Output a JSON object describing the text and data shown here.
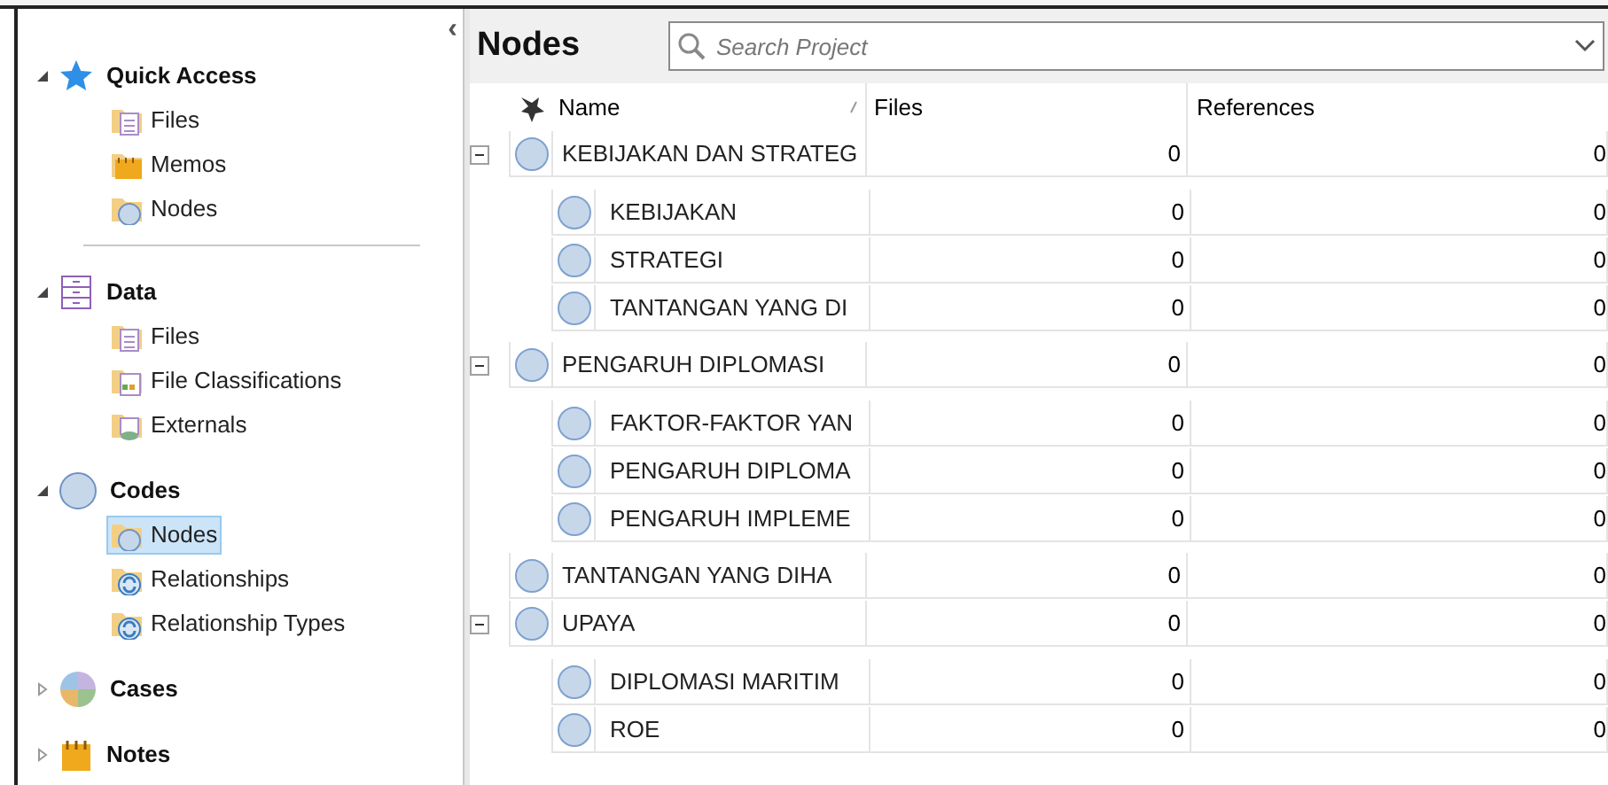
{
  "sidebar": {
    "collapse_glyph": "‹",
    "sections": [
      {
        "title": "Quick Access",
        "kind": "star",
        "expanded": true,
        "items": [
          {
            "label": "Files",
            "kind": "files",
            "selected": false
          },
          {
            "label": "Memos",
            "kind": "memos",
            "selected": false
          },
          {
            "label": "Nodes",
            "kind": "nodes",
            "selected": false
          }
        ]
      },
      {
        "title": "Data",
        "kind": "data",
        "expanded": true,
        "items": [
          {
            "label": "Files",
            "kind": "files",
            "selected": false
          },
          {
            "label": "File Classifications",
            "kind": "classifications",
            "selected": false
          },
          {
            "label": "Externals",
            "kind": "externals",
            "selected": false
          }
        ]
      },
      {
        "title": "Codes",
        "kind": "codes",
        "expanded": true,
        "items": [
          {
            "label": "Nodes",
            "kind": "nodes",
            "selected": true
          },
          {
            "label": "Relationships",
            "kind": "relationships",
            "selected": false
          },
          {
            "label": "Relationship Types",
            "kind": "relationships",
            "selected": false
          }
        ]
      },
      {
        "title": "Cases",
        "kind": "cases",
        "expanded": false
      },
      {
        "title": "Notes",
        "kind": "notes",
        "expanded": false
      }
    ]
  },
  "main": {
    "title": "Nodes",
    "search": {
      "placeholder": "Search Project"
    },
    "columns": [
      "Name",
      "Files",
      "References"
    ],
    "nodes": [
      {
        "name": "KEBIJAKAN DAN STRATEG",
        "files": "0",
        "references": "0",
        "expanded": true,
        "children": [
          {
            "name": "KEBIJAKAN",
            "files": "0",
            "references": "0"
          },
          {
            "name": "STRATEGI",
            "files": "0",
            "references": "0"
          },
          {
            "name": "TANTANGAN YANG DI",
            "files": "0",
            "references": "0"
          }
        ]
      },
      {
        "name": "PENGARUH DIPLOMASI",
        "files": "0",
        "references": "0",
        "expanded": true,
        "children": [
          {
            "name": "FAKTOR-FAKTOR YAN",
            "files": "0",
            "references": "0"
          },
          {
            "name": "PENGARUH DIPLOMA",
            "files": "0",
            "references": "0"
          },
          {
            "name": "PENGARUH IMPLEME",
            "files": "0",
            "references": "0"
          }
        ]
      },
      {
        "name": "TANTANGAN YANG DIHA",
        "files": "0",
        "references": "0"
      },
      {
        "name": "UPAYA",
        "files": "0",
        "references": "0",
        "expanded": true,
        "children": [
          {
            "name": "DIPLOMASI MARITIM",
            "files": "0",
            "references": "0"
          },
          {
            "name": "ROE",
            "files": "0",
            "references": "0"
          }
        ]
      }
    ]
  }
}
